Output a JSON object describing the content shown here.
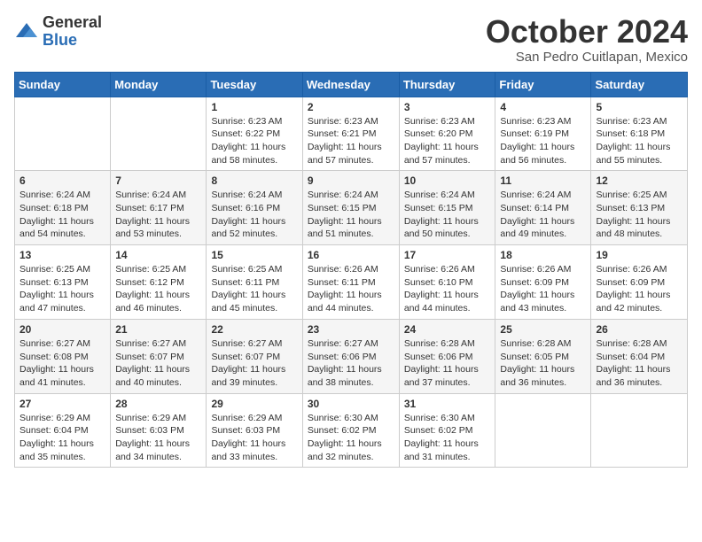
{
  "header": {
    "logo_general": "General",
    "logo_blue": "Blue",
    "month_title": "October 2024",
    "subtitle": "San Pedro Cuitlapan, Mexico"
  },
  "weekdays": [
    "Sunday",
    "Monday",
    "Tuesday",
    "Wednesday",
    "Thursday",
    "Friday",
    "Saturday"
  ],
  "weeks": [
    [
      {
        "day": "",
        "info": ""
      },
      {
        "day": "",
        "info": ""
      },
      {
        "day": "1",
        "info": "Sunrise: 6:23 AM\nSunset: 6:22 PM\nDaylight: 11 hours\nand 58 minutes."
      },
      {
        "day": "2",
        "info": "Sunrise: 6:23 AM\nSunset: 6:21 PM\nDaylight: 11 hours\nand 57 minutes."
      },
      {
        "day": "3",
        "info": "Sunrise: 6:23 AM\nSunset: 6:20 PM\nDaylight: 11 hours\nand 57 minutes."
      },
      {
        "day": "4",
        "info": "Sunrise: 6:23 AM\nSunset: 6:19 PM\nDaylight: 11 hours\nand 56 minutes."
      },
      {
        "day": "5",
        "info": "Sunrise: 6:23 AM\nSunset: 6:18 PM\nDaylight: 11 hours\nand 55 minutes."
      }
    ],
    [
      {
        "day": "6",
        "info": "Sunrise: 6:24 AM\nSunset: 6:18 PM\nDaylight: 11 hours\nand 54 minutes."
      },
      {
        "day": "7",
        "info": "Sunrise: 6:24 AM\nSunset: 6:17 PM\nDaylight: 11 hours\nand 53 minutes."
      },
      {
        "day": "8",
        "info": "Sunrise: 6:24 AM\nSunset: 6:16 PM\nDaylight: 11 hours\nand 52 minutes."
      },
      {
        "day": "9",
        "info": "Sunrise: 6:24 AM\nSunset: 6:15 PM\nDaylight: 11 hours\nand 51 minutes."
      },
      {
        "day": "10",
        "info": "Sunrise: 6:24 AM\nSunset: 6:15 PM\nDaylight: 11 hours\nand 50 minutes."
      },
      {
        "day": "11",
        "info": "Sunrise: 6:24 AM\nSunset: 6:14 PM\nDaylight: 11 hours\nand 49 minutes."
      },
      {
        "day": "12",
        "info": "Sunrise: 6:25 AM\nSunset: 6:13 PM\nDaylight: 11 hours\nand 48 minutes."
      }
    ],
    [
      {
        "day": "13",
        "info": "Sunrise: 6:25 AM\nSunset: 6:13 PM\nDaylight: 11 hours\nand 47 minutes."
      },
      {
        "day": "14",
        "info": "Sunrise: 6:25 AM\nSunset: 6:12 PM\nDaylight: 11 hours\nand 46 minutes."
      },
      {
        "day": "15",
        "info": "Sunrise: 6:25 AM\nSunset: 6:11 PM\nDaylight: 11 hours\nand 45 minutes."
      },
      {
        "day": "16",
        "info": "Sunrise: 6:26 AM\nSunset: 6:11 PM\nDaylight: 11 hours\nand 44 minutes."
      },
      {
        "day": "17",
        "info": "Sunrise: 6:26 AM\nSunset: 6:10 PM\nDaylight: 11 hours\nand 44 minutes."
      },
      {
        "day": "18",
        "info": "Sunrise: 6:26 AM\nSunset: 6:09 PM\nDaylight: 11 hours\nand 43 minutes."
      },
      {
        "day": "19",
        "info": "Sunrise: 6:26 AM\nSunset: 6:09 PM\nDaylight: 11 hours\nand 42 minutes."
      }
    ],
    [
      {
        "day": "20",
        "info": "Sunrise: 6:27 AM\nSunset: 6:08 PM\nDaylight: 11 hours\nand 41 minutes."
      },
      {
        "day": "21",
        "info": "Sunrise: 6:27 AM\nSunset: 6:07 PM\nDaylight: 11 hours\nand 40 minutes."
      },
      {
        "day": "22",
        "info": "Sunrise: 6:27 AM\nSunset: 6:07 PM\nDaylight: 11 hours\nand 39 minutes."
      },
      {
        "day": "23",
        "info": "Sunrise: 6:27 AM\nSunset: 6:06 PM\nDaylight: 11 hours\nand 38 minutes."
      },
      {
        "day": "24",
        "info": "Sunrise: 6:28 AM\nSunset: 6:06 PM\nDaylight: 11 hours\nand 37 minutes."
      },
      {
        "day": "25",
        "info": "Sunrise: 6:28 AM\nSunset: 6:05 PM\nDaylight: 11 hours\nand 36 minutes."
      },
      {
        "day": "26",
        "info": "Sunrise: 6:28 AM\nSunset: 6:04 PM\nDaylight: 11 hours\nand 36 minutes."
      }
    ],
    [
      {
        "day": "27",
        "info": "Sunrise: 6:29 AM\nSunset: 6:04 PM\nDaylight: 11 hours\nand 35 minutes."
      },
      {
        "day": "28",
        "info": "Sunrise: 6:29 AM\nSunset: 6:03 PM\nDaylight: 11 hours\nand 34 minutes."
      },
      {
        "day": "29",
        "info": "Sunrise: 6:29 AM\nSunset: 6:03 PM\nDaylight: 11 hours\nand 33 minutes."
      },
      {
        "day": "30",
        "info": "Sunrise: 6:30 AM\nSunset: 6:02 PM\nDaylight: 11 hours\nand 32 minutes."
      },
      {
        "day": "31",
        "info": "Sunrise: 6:30 AM\nSunset: 6:02 PM\nDaylight: 11 hours\nand 31 minutes."
      },
      {
        "day": "",
        "info": ""
      },
      {
        "day": "",
        "info": ""
      }
    ]
  ]
}
